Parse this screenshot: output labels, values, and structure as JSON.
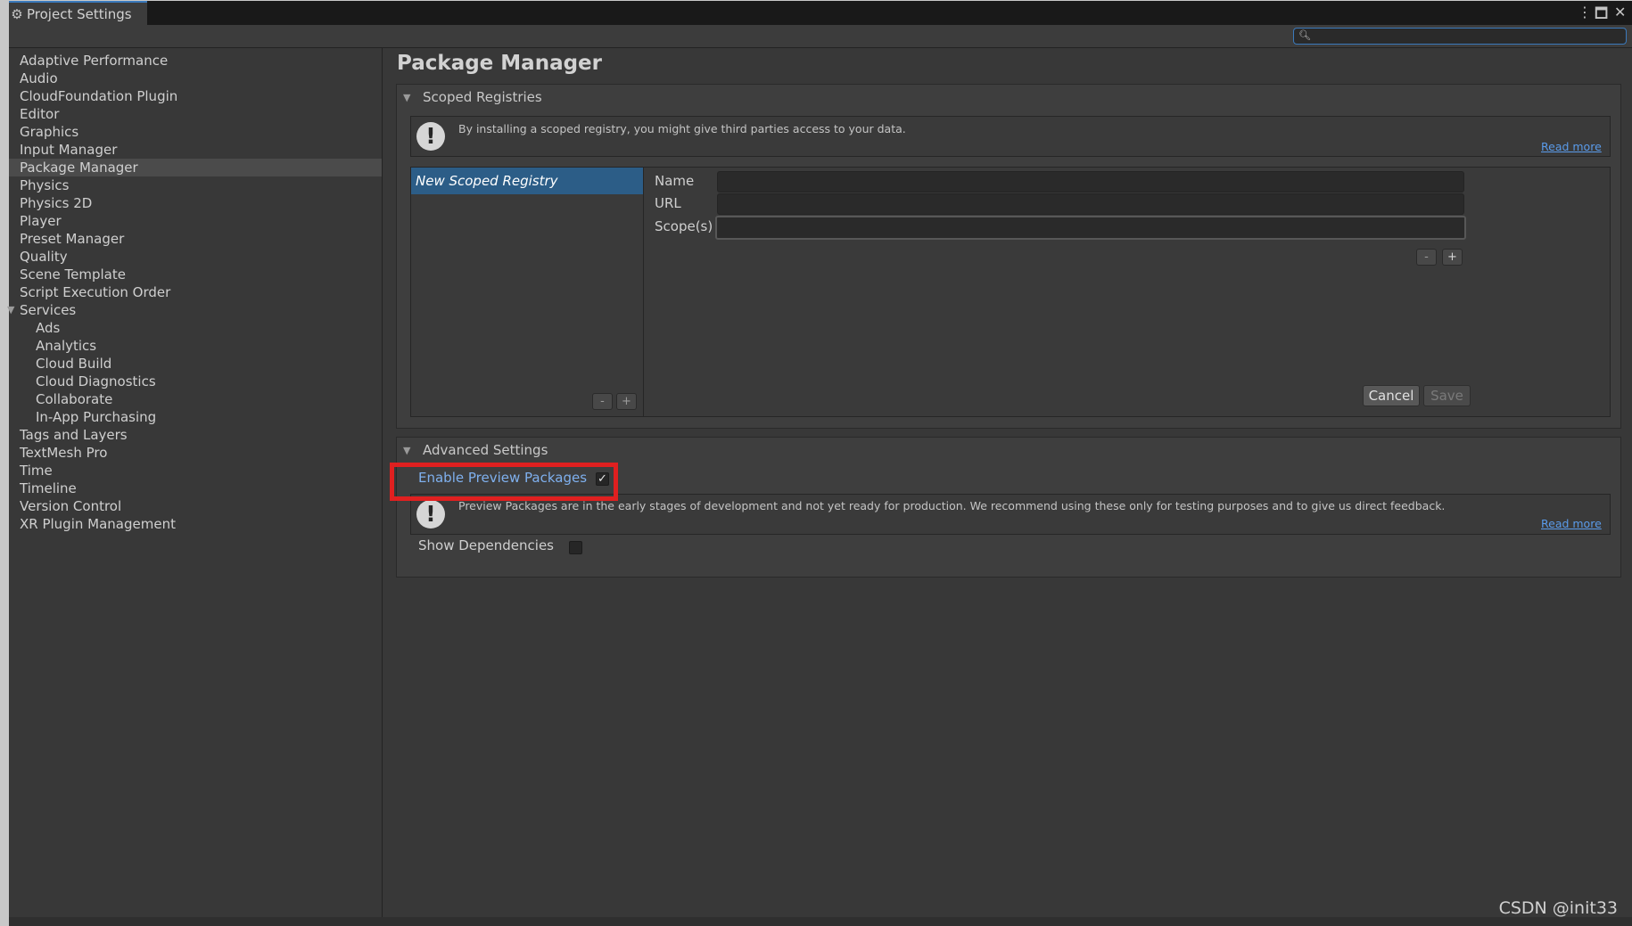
{
  "window": {
    "tab_title": "Project Settings",
    "tab_icon": "gear-icon",
    "menu_icon": "⋮",
    "maximize_icon": "🗖",
    "close_icon": "✕"
  },
  "search": {
    "placeholder": "",
    "value": ""
  },
  "sidebar": {
    "items": [
      {
        "label": "Adaptive Performance"
      },
      {
        "label": "Audio"
      },
      {
        "label": "CloudFoundation Plugin"
      },
      {
        "label": "Editor"
      },
      {
        "label": "Graphics"
      },
      {
        "label": "Input Manager"
      },
      {
        "label": "Package Manager"
      },
      {
        "label": "Physics"
      },
      {
        "label": "Physics 2D"
      },
      {
        "label": "Player"
      },
      {
        "label": "Preset Manager"
      },
      {
        "label": "Quality"
      },
      {
        "label": "Scene Template"
      },
      {
        "label": "Script Execution Order"
      },
      {
        "label": "Services"
      },
      {
        "label": "Ads"
      },
      {
        "label": "Analytics"
      },
      {
        "label": "Cloud Build"
      },
      {
        "label": "Cloud Diagnostics"
      },
      {
        "label": "Collaborate"
      },
      {
        "label": "In-App Purchasing"
      },
      {
        "label": "Tags and Layers"
      },
      {
        "label": "TextMesh Pro"
      },
      {
        "label": "Time"
      },
      {
        "label": "Timeline"
      },
      {
        "label": "Version Control"
      },
      {
        "label": "XR Plugin Management"
      }
    ],
    "selected": "Package Manager"
  },
  "main": {
    "title": "Package Manager",
    "scoped": {
      "title": "Scoped Registries",
      "info": "By installing a scoped registry, you might give third parties access to your data.",
      "read_more": "Read more",
      "list_item": "New Scoped Registry",
      "minus": "-",
      "plus": "+",
      "name_label": "Name",
      "url_label": "URL",
      "scopes_label": "Scope(s)",
      "name_value": "",
      "url_value": "",
      "scopes_value": "",
      "cancel": "Cancel",
      "save": "Save"
    },
    "advanced": {
      "title": "Advanced Settings",
      "preview_label": "Enable Preview Packages",
      "preview_checked": "✓",
      "info": "Preview Packages are in the early stages of development and not yet ready for production. We recommend using these only for testing purposes and to give us direct feedback.",
      "read_more": "Read more",
      "deps_label": "Show Dependencies",
      "deps_checked": ""
    }
  },
  "watermark": "CSDN @init33",
  "colors": {
    "highlight": "#e02020",
    "accent": "#3a79bb",
    "selection": "#2c5d87",
    "link": "#5a9bea"
  }
}
